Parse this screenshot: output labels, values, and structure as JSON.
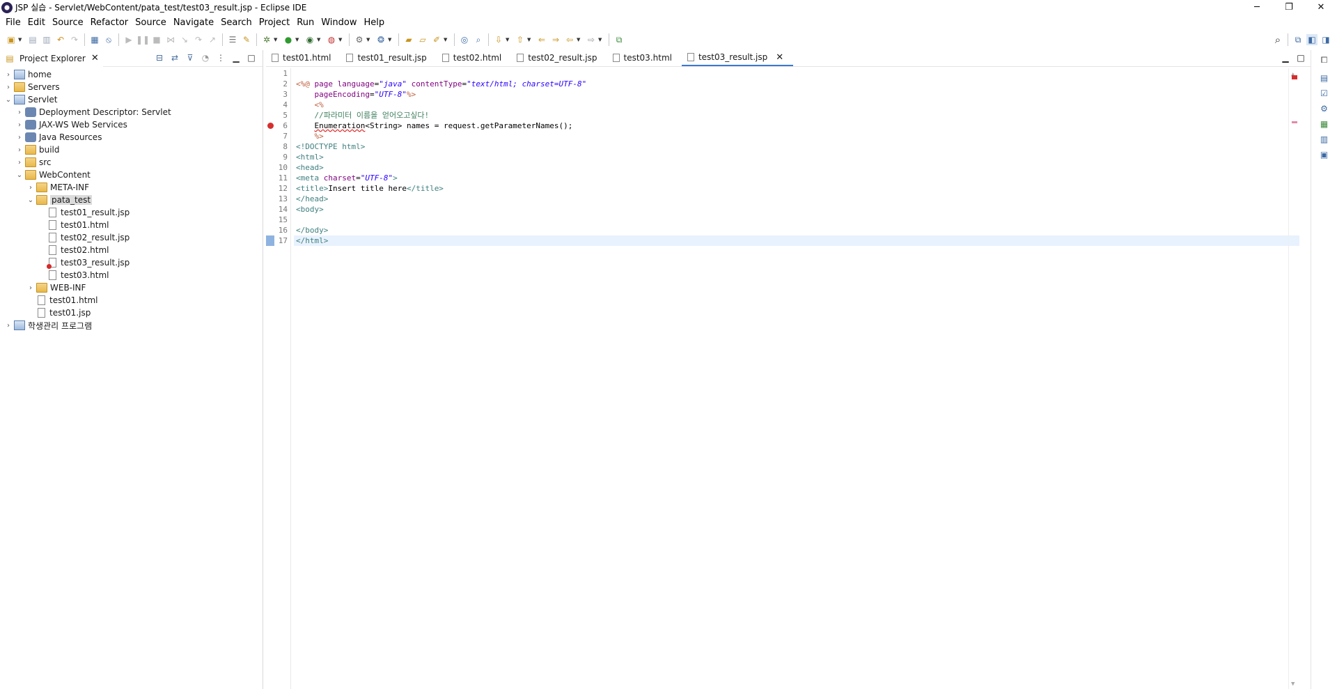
{
  "window": {
    "title": "JSP 실습 - Servlet/WebContent/pata_test/test03_result.jsp - Eclipse IDE",
    "controls": {
      "minimize": "─",
      "maximize": "❐",
      "close": "✕"
    }
  },
  "menu": [
    "File",
    "Edit",
    "Source",
    "Refactor",
    "Source",
    "Navigate",
    "Search",
    "Project",
    "Run",
    "Window",
    "Help"
  ],
  "explorer": {
    "title": "Project Explorer",
    "tree": [
      {
        "label": "home",
        "arrow": "›",
        "depth": 0,
        "icon": "project-icon"
      },
      {
        "label": "Servers",
        "arrow": "›",
        "depth": 0,
        "icon": "folder-icon"
      },
      {
        "label": "Servlet",
        "arrow": "⌄",
        "depth": 0,
        "icon": "project-icon"
      },
      {
        "label": "Deployment Descriptor: Servlet",
        "arrow": "›",
        "depth": 1,
        "icon": "descriptor-icon"
      },
      {
        "label": "JAX-WS Web Services",
        "arrow": "›",
        "depth": 1,
        "icon": "webservice-icon"
      },
      {
        "label": "Java Resources",
        "arrow": "›",
        "depth": 1,
        "icon": "library-icon"
      },
      {
        "label": "build",
        "arrow": "›",
        "depth": 1,
        "icon": "folder-icon"
      },
      {
        "label": "src",
        "arrow": "›",
        "depth": 1,
        "icon": "folder-icon"
      },
      {
        "label": "WebContent",
        "arrow": "⌄",
        "depth": 1,
        "icon": "folder-icon"
      },
      {
        "label": "META-INF",
        "arrow": "›",
        "depth": 2,
        "icon": "folder-icon"
      },
      {
        "label": "pata_test",
        "arrow": "⌄",
        "depth": 2,
        "icon": "folder-icon",
        "selected": true
      },
      {
        "label": "test01_result.jsp",
        "arrow": "",
        "depth": 3,
        "icon": "jsp-file-icon"
      },
      {
        "label": "test01.html",
        "arrow": "",
        "depth": 3,
        "icon": "html-file-icon"
      },
      {
        "label": "test02_result.jsp",
        "arrow": "",
        "depth": 3,
        "icon": "jsp-file-icon"
      },
      {
        "label": "test02.html",
        "arrow": "",
        "depth": 3,
        "icon": "html-file-icon"
      },
      {
        "label": "test03_result.jsp",
        "arrow": "",
        "depth": 3,
        "icon": "jsp-file-error-icon",
        "error": true
      },
      {
        "label": "test03.html",
        "arrow": "",
        "depth": 3,
        "icon": "html-file-icon"
      },
      {
        "label": "WEB-INF",
        "arrow": "›",
        "depth": 2,
        "icon": "folder-icon"
      },
      {
        "label": "test01.html",
        "arrow": "",
        "depth": 2,
        "icon": "html-file-icon"
      },
      {
        "label": "test01.jsp",
        "arrow": "",
        "depth": 2,
        "icon": "jsp-file-icon"
      },
      {
        "label": "학생관리 프로그램",
        "arrow": "›",
        "depth": 0,
        "icon": "project-icon"
      }
    ]
  },
  "editor": {
    "tabs": [
      {
        "label": "test01.html",
        "active": false
      },
      {
        "label": "test01_result.jsp",
        "active": false
      },
      {
        "label": "test02.html",
        "active": false
      },
      {
        "label": "test02_result.jsp",
        "active": false
      },
      {
        "label": "test03.html",
        "active": false
      },
      {
        "label": "test03_result.jsp",
        "active": true
      }
    ],
    "line_numbers": [
      "1",
      "2",
      "3",
      "4",
      "5",
      "6",
      "7",
      "8",
      "9",
      "10",
      "11",
      "12",
      "13",
      "14",
      "15",
      "16",
      "17"
    ],
    "error_line": 6,
    "current_line": 17
  }
}
